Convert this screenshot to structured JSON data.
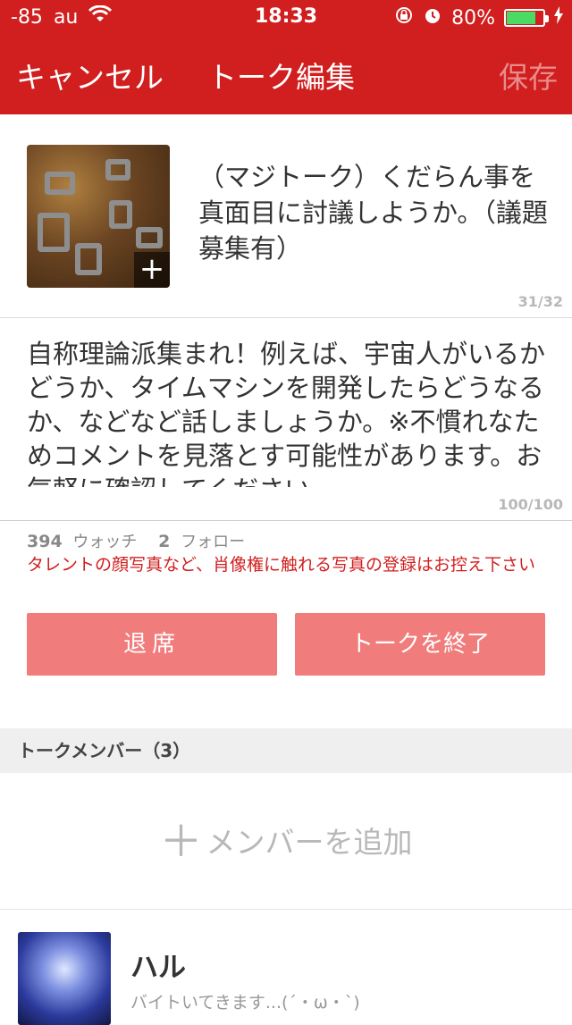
{
  "status_bar": {
    "signal": "-85",
    "carrier": "au",
    "time": "18:33",
    "battery_percent": "80%",
    "battery_level": 0.8,
    "icons": [
      "wifi-icon",
      "rotation-lock-icon",
      "alarm-icon",
      "battery-icon",
      "charging-icon"
    ]
  },
  "nav": {
    "cancel_label": "キャンセル",
    "title": "トーク編集",
    "save_label": "保存"
  },
  "talk": {
    "title": "（マジトーク）くだらん事を真面目に討議しようか。（議題募集有）",
    "title_counter": "31/32",
    "description": "自称理論派集まれ！例えば、宇宙人がいるかどうか、タイムマシンを開発したらどうなるか、などなど話しましょうか。※不慣れなためコメントを見落とす可能性があります。お気軽に確認してください。",
    "description_counter": "100/100"
  },
  "stats": {
    "watch_count": "394",
    "watch_label": "ウォッチ",
    "follow_count": "2",
    "follow_label": "フォロー"
  },
  "warning": "タレントの顔写真など、肖像権に触れる写真の登録はお控え下さい",
  "buttons": {
    "leave": "退席",
    "end_talk": "トークを終了"
  },
  "members_section": {
    "header": "トークメンバー（3）",
    "add_label": "メンバーを追加",
    "members": [
      {
        "name": "ハル",
        "status": "バイトいてきます...(´・ω・`)"
      }
    ]
  },
  "colors": {
    "brand_red": "#d11e1e",
    "button_red": "#f07c7c",
    "save_disabled": "#e98b8b"
  }
}
